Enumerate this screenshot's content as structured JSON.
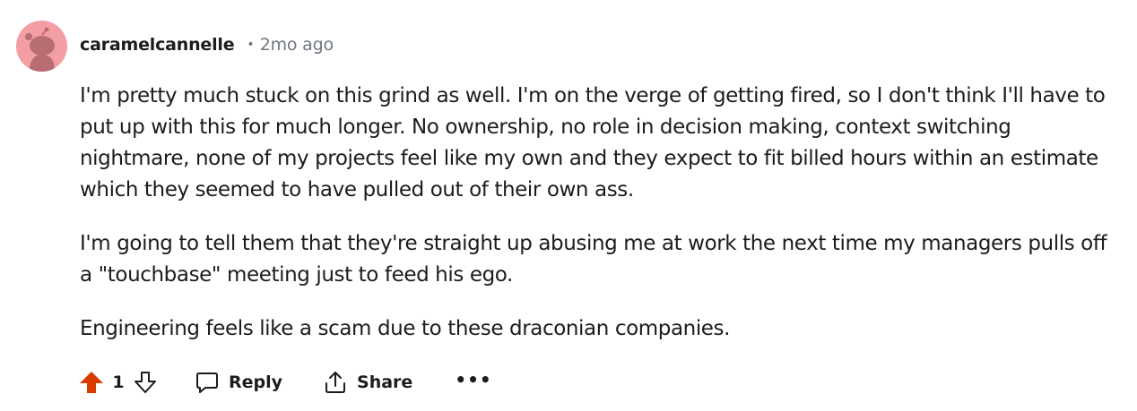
{
  "comment": {
    "username": "caramelcannelle",
    "separator": "•",
    "timestamp": "2mo ago",
    "paragraphs": [
      "I'm pretty much stuck on this grind as well. I'm on the verge of getting fired, so I don't think I'll have to put up with this for much longer. No ownership, no role in decision making, context switching nightmare, none of my projects feel like my own and they expect to fit billed hours within an estimate which they seemed to have pulled out of their own ass.",
      "I'm going to tell them that they're straight up abusing me at work the next time my managers pulls off a \"touchbase\" meeting just to feed his ego.",
      "Engineering feels like a scam due to these draconian companies."
    ]
  },
  "actions": {
    "upvote_icon": "upvote-arrow-icon",
    "vote_count": "1",
    "downvote_icon": "downvote-arrow-icon",
    "reply_label": "Reply",
    "share_label": "Share",
    "more_label": "•••"
  },
  "colors": {
    "upvote_active": "#d93a00",
    "avatar_bg": "#f39ea4",
    "avatar_figure": "#b86d73",
    "muted_text": "#6f7680",
    "text": "#1c1c1c"
  }
}
